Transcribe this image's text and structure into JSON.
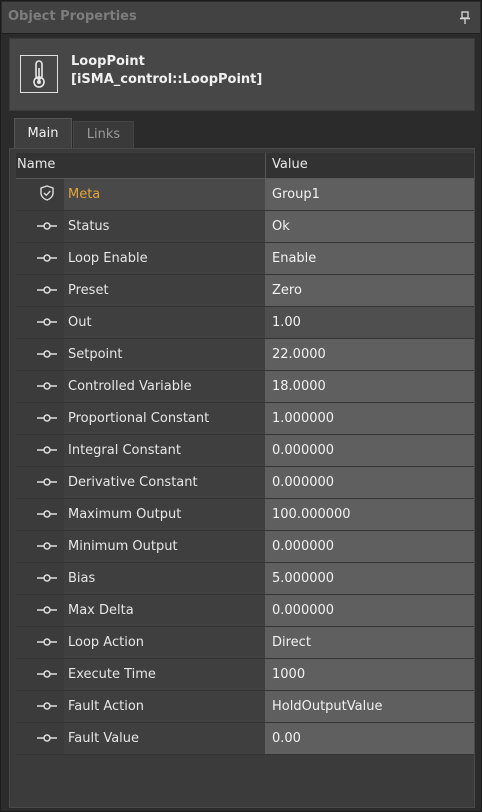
{
  "panel": {
    "title": "Object Properties",
    "pin_icon": "pin-icon"
  },
  "object": {
    "name": "LoopPoint",
    "type": "[iSMA_control::LoopPoint]",
    "icon": "thermometer-icon"
  },
  "tabs": [
    {
      "label": "Main",
      "active": true
    },
    {
      "label": "Links",
      "active": false
    }
  ],
  "grid": {
    "col_name": "Name",
    "col_value": "Value",
    "rows": [
      {
        "label": "Meta",
        "value": "Group1",
        "icon": "shield-check-icon"
      },
      {
        "label": "Status",
        "value": "Ok",
        "icon": "slot-connector-icon"
      },
      {
        "label": "Loop Enable",
        "value": "Enable",
        "icon": "slot-connector-icon"
      },
      {
        "label": "Preset",
        "value": "Zero",
        "icon": "slot-connector-icon"
      },
      {
        "label": "Out",
        "value": "1.00",
        "icon": "slot-connector-icon"
      },
      {
        "label": "Setpoint",
        "value": "22.0000",
        "icon": "slot-connector-icon"
      },
      {
        "label": "Controlled Variable",
        "value": "18.0000",
        "icon": "slot-connector-icon"
      },
      {
        "label": "Proportional Constant",
        "value": "1.000000",
        "icon": "slot-connector-icon"
      },
      {
        "label": "Integral Constant",
        "value": "0.000000",
        "icon": "slot-connector-icon"
      },
      {
        "label": "Derivative Constant",
        "value": "0.000000",
        "icon": "slot-connector-icon"
      },
      {
        "label": "Maximum Output",
        "value": "100.000000",
        "icon": "slot-connector-icon"
      },
      {
        "label": "Minimum Output",
        "value": "0.000000",
        "icon": "slot-connector-icon"
      },
      {
        "label": "Bias",
        "value": "5.000000",
        "icon": "slot-connector-icon"
      },
      {
        "label": "Max Delta",
        "value": "0.000000",
        "icon": "slot-connector-icon"
      },
      {
        "label": "Loop Action",
        "value": "Direct",
        "icon": "slot-connector-icon"
      },
      {
        "label": "Execute Time",
        "value": "1000",
        "icon": "slot-connector-icon"
      },
      {
        "label": "Fault Action",
        "value": "HoldOutputValue",
        "icon": "slot-connector-icon"
      },
      {
        "label": "Fault Value",
        "value": "0.00",
        "icon": "slot-connector-icon"
      }
    ]
  },
  "colors": {
    "meta_label": "#e3a43a",
    "value_cell": "#5f5f5f",
    "name_cell": "#3f3f3f"
  }
}
